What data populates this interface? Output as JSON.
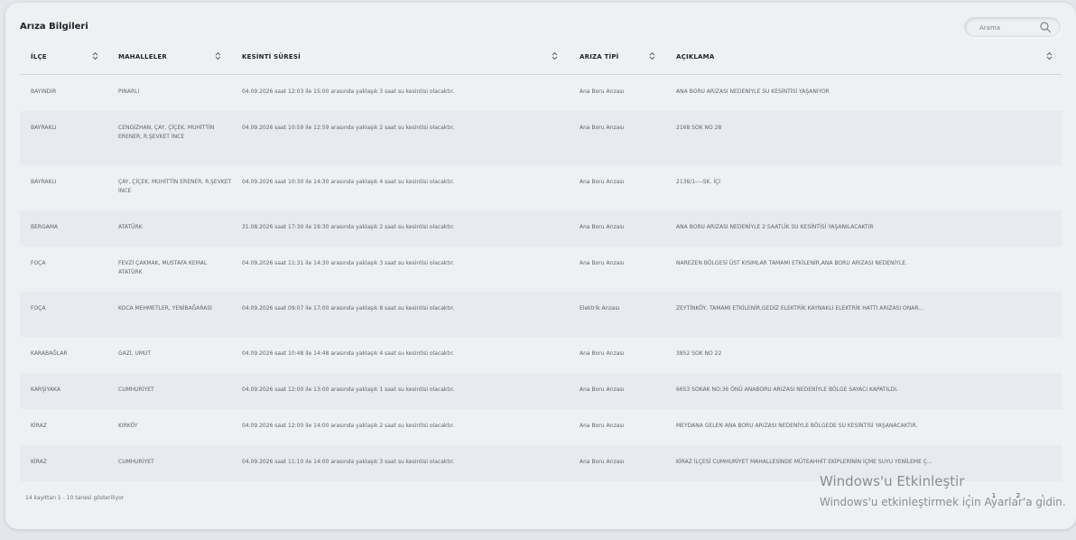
{
  "card": {
    "title": "Arıza Bilgileri"
  },
  "search": {
    "placeholder": "Arama"
  },
  "table": {
    "headers": [
      "İLÇE",
      "MAHALLELER",
      "KESİNTİ SÜRESİ",
      "ARIZA TİPİ",
      "AÇIKLAMA"
    ],
    "rows": [
      [
        "BAYINDIR",
        "PINARLI",
        "04.09.2026 saat 12:03 ile 15:00 arasında yaklaşık 3 saat su kesintisi olacaktır.",
        "Ana Boru Arızası",
        "ANA BORU ARIZASI NEDENİYLE SU KESİNTİSİ YAŞANIYOR"
      ],
      [
        "BAYRAKLI",
        "CENGİZHAN, ÇAY, ÇİÇEK, MUHİTTİN ERENER, R.ŞEVKET İNCE",
        "04.09.2026 saat 10:59 ile 12:59 arasında yaklaşık 2 saat su kesintisi olacaktır.",
        "Ana Boru Arızası",
        "2168 SOK NO 28"
      ],
      [
        "BAYRAKLI",
        "ÇAY, ÇİÇEK, MUHİTTİN ERENER, R.ŞEVKET İNCE",
        "04.09.2026 saat 10:30 ile 14:30 arasında yaklaşık 4 saat su kesintisi olacaktır.",
        "Ana Boru Arızası",
        "2136/1----SK. İÇİ"
      ],
      [
        "BERGAMA",
        "ATATÜRK",
        "31.08.2026 saat 17:30 ile 19:30 arasında yaklaşık 2 saat su kesintisi olacaktır.",
        "Ana Boru Arızası",
        "ANA BORU ARIZASI NEDENİYLE 2 SAATLİK SU KESİNTİSİ YAŞANILACAKTIR"
      ],
      [
        "FOÇA",
        "FEVZİ ÇAKMAK, MUSTAFA KEMAL ATATÜRK",
        "04.09.2026 saat 11:31 ile 14:30 arasında yaklaşık 3 saat su kesintisi olacaktır.",
        "Ana Boru Arızası",
        "NAREZEN BÖLGESİ ÜST KISIMLAR TAMAMI ETKİLENİR,ANA BORU ARIZASI NEDENİYLE."
      ],
      [
        "FOÇA",
        "KOCA MEHMETLER, YENİBAĞARASI",
        "04.09.2026 saat 09:07 ile 17:00 arasında yaklaşık 8 saat su kesintisi olacaktır.",
        "Elektrik Arızası",
        "ZEYTİNKÖY, TAMAMI ETKİLENİR,GEDİZ ELEKTRİK KAYNAKLI ELEKTRİK HATTI ARIZASI ONAR..."
      ],
      [
        "KARABAĞLAR",
        "GAZİ, UMUT",
        "04.09.2026 saat 10:48 ile 14:48 arasında yaklaşık 4 saat su kesintisi olacaktır.",
        "Ana Boru Arızası",
        "3852 SOK NO 22"
      ],
      [
        "KARŞIYAKA",
        "CUMHURİYET",
        "04.09.2026 saat 12:00 ile 13:00 arasında yaklaşık 1 saat su kesintisi olacaktır.",
        "Ana Boru Arızası",
        "6653 SOKAK NO:36 ÖNÜ ANABORU ARIZASI NEDENİYLE BÖLGE SAYACI KAPATILDI."
      ],
      [
        "KİRAZ",
        "KIRKÖY",
        "04.09.2026 saat 12:00 ile 14:00 arasında yaklaşık 2 saat su kesintisi olacaktır.",
        "Ana Boru Arızası",
        "MEYDANA GELEN ANA BORU ARIZASI NEDENİYLE BÖLGEDE SU KESİNTİSİ YAŞANACAKTIR."
      ],
      [
        "KİRAZ",
        "CUMHURİYET",
        "04.09.2026 saat 11:10 ile 14:00 arasında yaklaşık 3 saat su kesintisi olacaktır.",
        "Ana Boru Arızası",
        "KİRAZ İLÇESİ CUMHURİYET MAHALLESİNDE MÜTEAHHİT EKİPLERİNİN İÇME SUYU YENİLEME Ç..."
      ]
    ]
  },
  "footer": {
    "info": "14 kayıttan 1 - 10 tanesi gösteriliyor"
  },
  "pagination": {
    "prev": "‹",
    "pages": [
      "1",
      "2"
    ],
    "next": "›"
  },
  "windows_watermark": {
    "title": "Windows'u Etkinleştir",
    "subtitle": "Windows'u etkinleştirmek için Ayarlar'a gidin."
  }
}
